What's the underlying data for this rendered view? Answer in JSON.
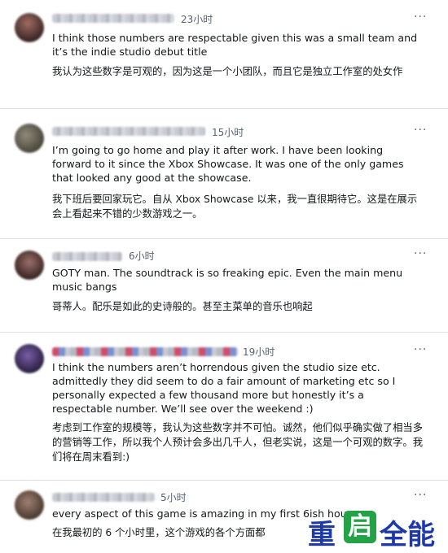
{
  "posts": [
    {
      "time": "23小时",
      "en": "I think those numbers are respectable given this was a small team and it’s the indie studio debut title",
      "zh": "我认为这些数字是可观的，因为这是一个小团队，而且它是独立工作室的处女作"
    },
    {
      "time": "15小时",
      "en": "I’m going to go home and play it after work. I have been looking forward to it since the Xbox Showcase. It was one of the only games that looked any good at the showcase.",
      "zh": "我下班后要回家玩它。自从 Xbox Showcase 以来，我一直很期待它。这是在展示会上看起来不错的少数游戏之一。"
    },
    {
      "time": "6小时",
      "en": "GOTY man. The soundtrack is so freaking epic. Even the main menu music bangs",
      "zh": "哥蒂人。配乐是如此的史诗般的。甚至主菜单的音乐也响起"
    },
    {
      "time": "19小时",
      "en": "I think the numbers aren’t horrendous given the studio size etc. admittedly they did seem to do a fair amount of marketing etc so I personally expected a few thousand more but honestly it’s a respectable number. We’ll see over the weekend :)",
      "zh": "考虑到工作室的规模等，我认为这些数字并不可怕。诚然，他们似乎确实做了相当多的营销等工作，所以我个人预计会多出几千人，但老实说，这是一个可观的数字。我们将在周末看到:)"
    },
    {
      "time": "5小时",
      "en": "every aspect of this game is amazing in my first 6ish hours",
      "zh": "在我最初的 6 个小时里，这个游戏的各个方面都"
    }
  ],
  "more_icon": "···",
  "watermark": {
    "char1": "重",
    "char2": "启",
    "char3": "全能"
  }
}
